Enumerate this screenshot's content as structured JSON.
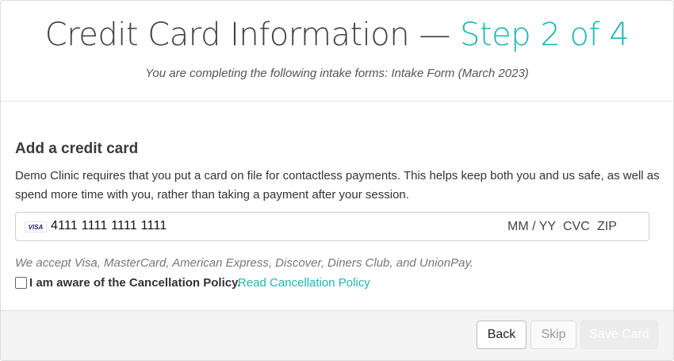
{
  "header": {
    "title_main": "Credit Card Information —",
    "title_step": "Step 2 of 4",
    "subtitle": "You are completing the following intake forms: Intake Form (March 2023)"
  },
  "card_section": {
    "title": "Add a credit card",
    "description": "Demo Clinic requires that you put a card on file for contactless payments. This helps keep both you and us safe, as well as spend more time with you, rather than taking a payment after your session.",
    "card_brand": "VISA",
    "card_number": "4111 1111 1111 1111",
    "expiry_placeholder": "MM / YY",
    "cvc_placeholder": "CVC",
    "zip_placeholder": "ZIP",
    "accepted_cards": "We accept Visa, MasterCard, American Express, Discover, Diners Club, and UnionPay.",
    "policy_label": "I am aware of the Cancellation Policy.",
    "policy_link": "Read Cancellation Policy",
    "policy_checked": false
  },
  "footer": {
    "back_label": "Back",
    "skip_label": "Skip",
    "save_label": "Save Card"
  },
  "colors": {
    "accent": "#1fb5b5",
    "footer_bg": "#f4f4f4"
  }
}
